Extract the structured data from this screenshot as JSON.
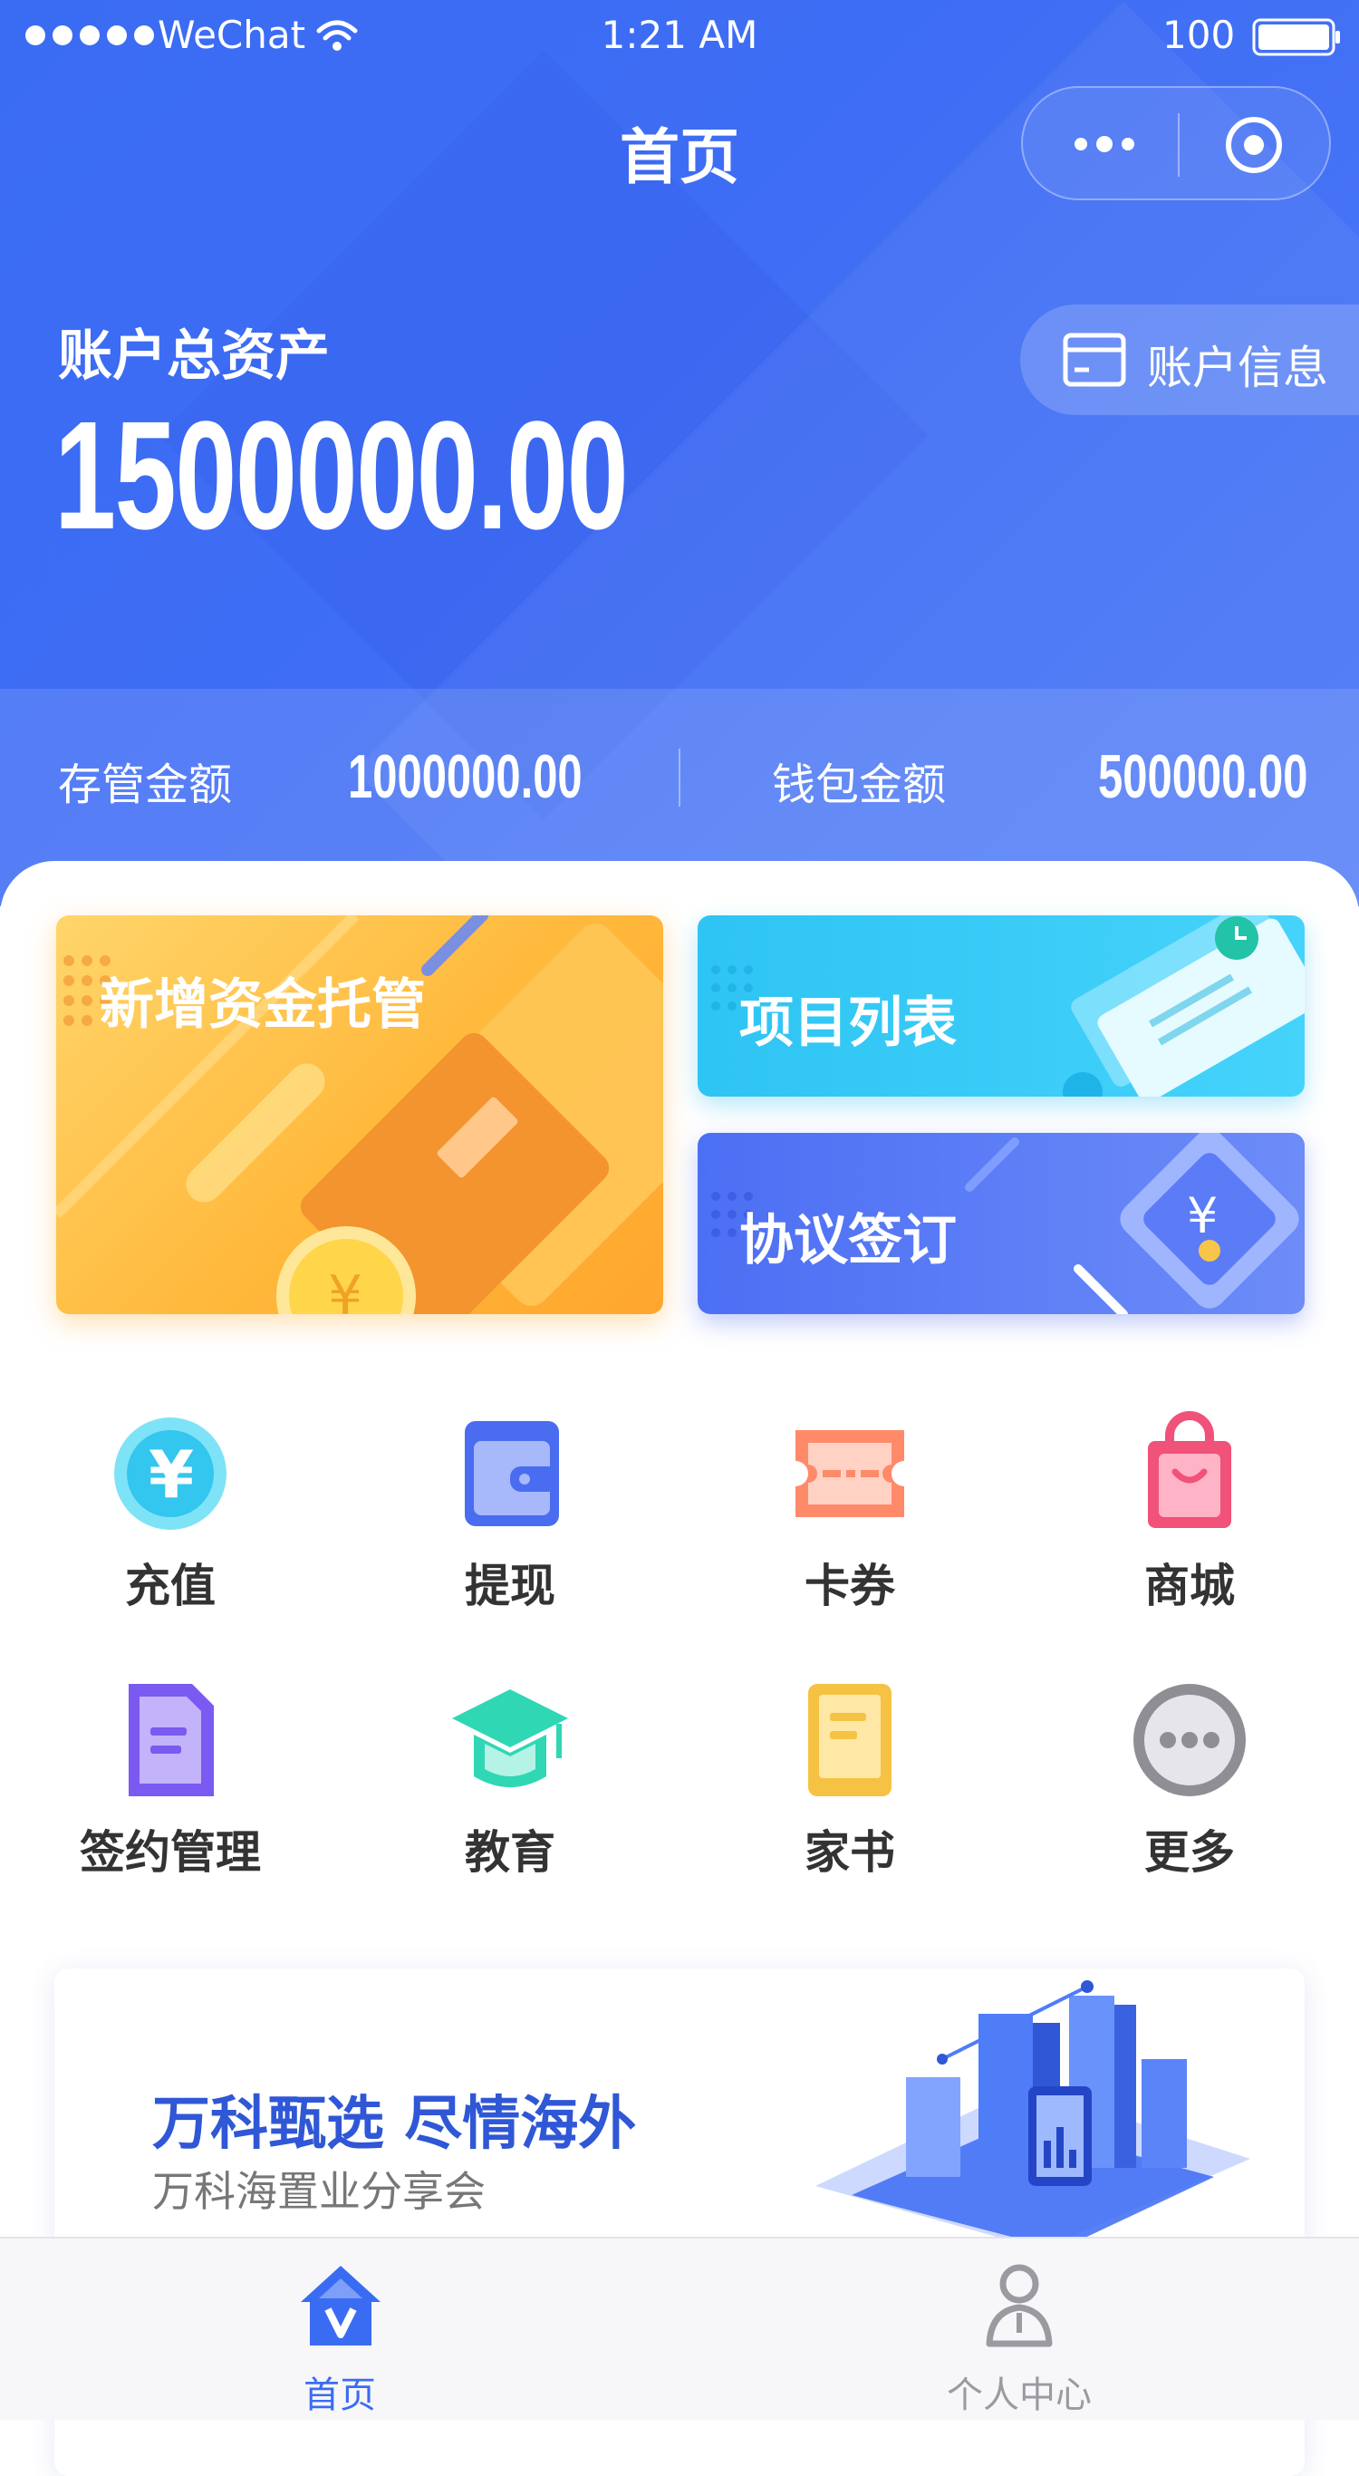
{
  "status_bar": {
    "carrier": "WeChat",
    "time": "1:21 AM",
    "battery": "100"
  },
  "nav": {
    "title": "首页"
  },
  "hero": {
    "label": "账户总资产",
    "amount": "1500000.00",
    "account_info_label": "账户信息",
    "custody_label": "存管金额",
    "custody_amount": "1000000.00",
    "wallet_label": "钱包金额",
    "wallet_amount": "500000.00"
  },
  "cards": {
    "new_custody": "新增资金托管",
    "project_list": "项目列表",
    "agreement": "协议签订"
  },
  "grid": [
    {
      "label": "充值",
      "icon": "recharge-yen-icon"
    },
    {
      "label": "提现",
      "icon": "wallet-withdraw-icon"
    },
    {
      "label": "卡券",
      "icon": "ticket-icon"
    },
    {
      "label": "商城",
      "icon": "shopping-bag-icon"
    },
    {
      "label": "签约管理",
      "icon": "document-icon"
    },
    {
      "label": "教育",
      "icon": "graduation-cap-icon"
    },
    {
      "label": "家书",
      "icon": "book-icon"
    },
    {
      "label": "更多",
      "icon": "more-icon"
    }
  ],
  "banner": {
    "title": "万科甄选 尽情海外",
    "subtitle": "万科海置业分享会"
  },
  "tabbar": [
    {
      "label": "首页",
      "active": true
    },
    {
      "label": "个人中心",
      "active": false
    }
  ],
  "colors": {
    "primary": "#3a6cf3",
    "tab_active": "#3a6cf3",
    "tab_inactive": "#999999"
  }
}
